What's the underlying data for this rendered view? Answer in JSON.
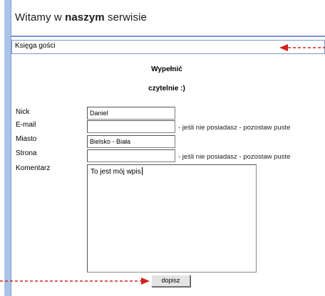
{
  "header": {
    "title_part1": "Witamy w ",
    "title_part2": "naszym",
    "title_part3": " serwisie"
  },
  "breadcrumb": {
    "label": "Księga gości"
  },
  "form": {
    "heading_line1": "Wypełnić",
    "heading_line2": "czytelnie :)",
    "fields": {
      "nick": {
        "label": "Nick",
        "value": "Daniel"
      },
      "email": {
        "label": "E-mail",
        "value": "",
        "hint": "- jeśli nie posiadasz - pozostaw puste"
      },
      "city": {
        "label": "Miasto",
        "value": "Bielsko - Biała"
      },
      "website": {
        "label": "Strona",
        "value": "",
        "hint": "- jeśli nie posiadasz - pozostaw puste"
      },
      "comment": {
        "label": "Komentarz",
        "value": "To jest mój wpis"
      }
    },
    "submit_label": "dopisz"
  },
  "annotations": {
    "arrow_color": "#d42020"
  },
  "colors": {
    "accent_bar": "#a9c4e6",
    "border_blue": "#7c95c8"
  }
}
